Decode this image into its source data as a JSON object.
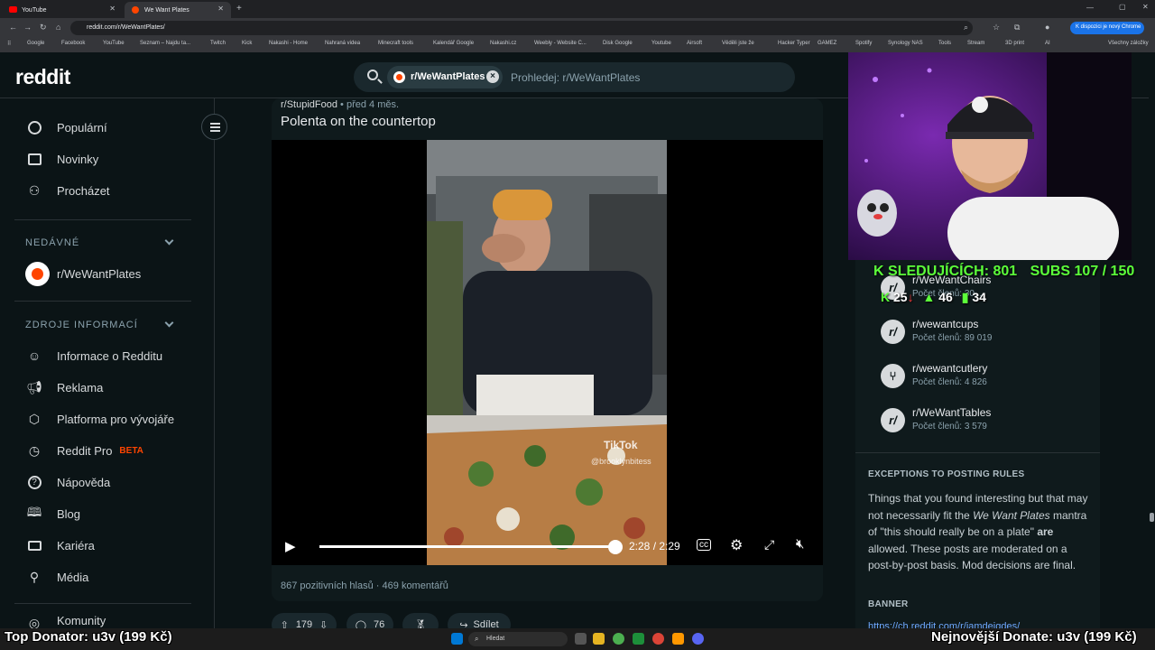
{
  "browser": {
    "tabs": [
      {
        "label": "YouTube"
      },
      {
        "label": "We Want Plates"
      }
    ],
    "url": "reddit.com/r/WeWantPlates/",
    "chrome_banner": "K dispozici je nový Chrome",
    "bookmarks": [
      "Google",
      "Facebook",
      "YouTube",
      "Seznam – Najdu ta...",
      "Twitch",
      "Kick",
      "Nakashi - Home",
      "Nahraná videa",
      "Minecraft tools",
      "Kalendář Google",
      "Nakashi.cz",
      "Weebly - Website C...",
      "Disk Google",
      "Youtube",
      "Airsoft",
      "Věděli jste že",
      "Hacker Typer",
      "GAMEZ",
      "Spotify",
      "Synology NAS",
      "Tools",
      "Stream",
      "3D print",
      "AI",
      "Všechny záložky"
    ]
  },
  "reddit": {
    "logo": "reddit",
    "search": {
      "chip": "r/WeWantPlates",
      "placeholder": "Prohledej: r/WeWantPlates"
    },
    "sidebar": {
      "nav": [
        {
          "label": "Populární",
          "icon": "popular-icon"
        },
        {
          "label": "Novinky",
          "icon": "news-icon"
        },
        {
          "label": "Procházet",
          "icon": "explore-icon"
        }
      ],
      "recent_heading": "NEDÁVNÉ",
      "recent_item": "r/WeWantPlates",
      "resources_heading": "ZDROJE INFORMACÍ",
      "resources": [
        {
          "label": "Informace o Redditu",
          "icon": "reddit-icon"
        },
        {
          "label": "Reklama",
          "icon": "megaphone-icon"
        },
        {
          "label": "Platforma pro vývojáře",
          "icon": "hexagon-icon"
        },
        {
          "label": "Reddit Pro",
          "icon": "clock-icon",
          "badge": "BETA"
        },
        {
          "label": "Nápověda",
          "icon": "help-icon"
        },
        {
          "label": "Blog",
          "icon": "book-icon"
        },
        {
          "label": "Kariéra",
          "icon": "briefcase-icon"
        },
        {
          "label": "Média",
          "icon": "link-icon"
        }
      ],
      "communities": "Komunity"
    },
    "post": {
      "subreddit": "r/StupidFood",
      "age": "• před 4 měs.",
      "title": "Polenta on the countertop",
      "video": {
        "time": "2:28 / 2:29",
        "progress_fraction": 0.993,
        "watermark_brand": "TikTok",
        "watermark_user": "@brooklynbitess"
      },
      "stats_votes": "867 pozitivních hlasů",
      "stats_comments": "469 komentářů",
      "actions": {
        "upvotes": "179",
        "comments": "76",
        "share": "Sdílet"
      }
    },
    "right": {
      "related": [
        {
          "name": "r/WeWantChairs",
          "members": "Počet členů: 30..."
        },
        {
          "name": "r/wewantcups",
          "members": "Počet členů: 89 019"
        },
        {
          "name": "r/wewantcutlery",
          "members": "Počet členů: 4 826"
        },
        {
          "name": "r/WeWantTables",
          "members": "Počet členů: 3 579"
        }
      ],
      "rules_heading": "EXCEPTIONS TO POSTING RULES",
      "rules_text_1": "Things that you found interesting but that may not necessarily fit the ",
      "rules_em": "We Want Plates",
      "rules_text_2": " mantra of \"this should really be on a plate\" ",
      "rules_bold": "are",
      "rules_text_3": " allowed. These posts are moderated on a post-by-post basis. Mod decisions are final.",
      "banner_heading": "BANNER",
      "banner_link": "https://ch.reddit.com/r/iamdeigdes/"
    }
  },
  "stream_overlay": {
    "followers": "SLEDUJÍCÍCH: 801",
    "subs": "SUBS 107 / 150",
    "count_kick": "25",
    "count_up": "46",
    "count_bars": "34",
    "top_donator": "Top Donator: u3v (199 Kč)",
    "latest_donate": "Nejnovější Donate: u3v (199 Kč)"
  },
  "taskbar": {
    "search": "Hledat"
  },
  "colors": {
    "reddit_bg": "#0b1416",
    "accent": "#ff4500",
    "overlay_green": "#5cff3a"
  }
}
